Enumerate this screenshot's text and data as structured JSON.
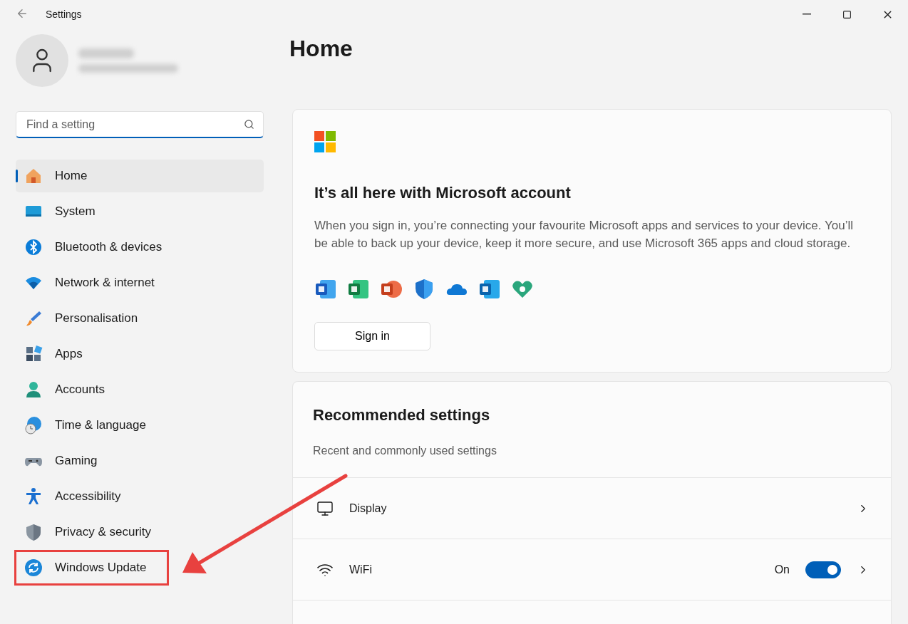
{
  "window": {
    "title": "Settings"
  },
  "search": {
    "placeholder": "Find a setting"
  },
  "nav": [
    {
      "label": "Home",
      "kind": "home",
      "selected": true,
      "highlighted": false
    },
    {
      "label": "System",
      "kind": "system",
      "selected": false,
      "highlighted": false
    },
    {
      "label": "Bluetooth & devices",
      "kind": "bluetooth",
      "selected": false,
      "highlighted": false
    },
    {
      "label": "Network & internet",
      "kind": "network",
      "selected": false,
      "highlighted": false
    },
    {
      "label": "Personalisation",
      "kind": "brush",
      "selected": false,
      "highlighted": false
    },
    {
      "label": "Apps",
      "kind": "apps",
      "selected": false,
      "highlighted": false
    },
    {
      "label": "Accounts",
      "kind": "accounts",
      "selected": false,
      "highlighted": false
    },
    {
      "label": "Time & language",
      "kind": "time",
      "selected": false,
      "highlighted": false
    },
    {
      "label": "Gaming",
      "kind": "gaming",
      "selected": false,
      "highlighted": false
    },
    {
      "label": "Accessibility",
      "kind": "accessibility",
      "selected": false,
      "highlighted": false
    },
    {
      "label": "Privacy & security",
      "kind": "shield",
      "selected": false,
      "highlighted": false
    },
    {
      "label": "Windows Update",
      "kind": "update",
      "selected": false,
      "highlighted": true
    }
  ],
  "page_title": "Home",
  "account_card": {
    "heading": "It’s all here with Microsoft account",
    "body": "When you sign in, you’re connecting your favourite Microsoft apps and services to your device. You’ll be able to back up your device, keep it more secure, and use Microsoft 365 apps and cloud storage.",
    "apps": [
      {
        "kind": "word"
      },
      {
        "kind": "excel"
      },
      {
        "kind": "powerpoint"
      },
      {
        "kind": "defender"
      },
      {
        "kind": "onedrive"
      },
      {
        "kind": "outlook"
      },
      {
        "kind": "family"
      }
    ],
    "button": "Sign in"
  },
  "recommended": {
    "heading": "Recommended settings",
    "subheading": "Recent and commonly used settings",
    "rows": [
      {
        "kind": "display",
        "label": "Display"
      },
      {
        "kind": "wifi",
        "label": "WiFi",
        "state_text": "On",
        "on": true
      }
    ]
  }
}
